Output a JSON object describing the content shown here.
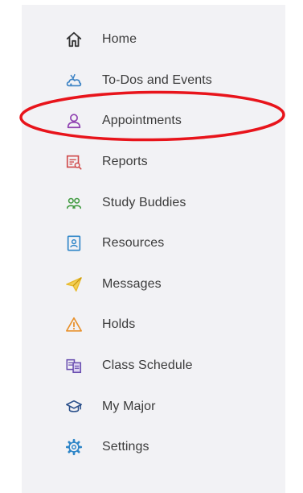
{
  "nav": {
    "items": [
      {
        "label": "Home",
        "icon": "home-icon",
        "color": "#333333"
      },
      {
        "label": "To-Dos and Events",
        "icon": "calendar-cloud-icon",
        "color": "#3b82c4"
      },
      {
        "label": "Appointments",
        "icon": "person-icon",
        "color": "#8e3fb0"
      },
      {
        "label": "Reports",
        "icon": "report-icon",
        "color": "#d04b4b"
      },
      {
        "label": "Study Buddies",
        "icon": "people-icon",
        "color": "#3f9a3f"
      },
      {
        "label": "Resources",
        "icon": "contact-book-icon",
        "color": "#2f86c8"
      },
      {
        "label": "Messages",
        "icon": "paper-plane-icon",
        "color": "#e7b92b"
      },
      {
        "label": "Holds",
        "icon": "warning-icon",
        "color": "#e8912c"
      },
      {
        "label": "Class Schedule",
        "icon": "schedule-icon",
        "color": "#6a4fb0"
      },
      {
        "label": "My Major",
        "icon": "graduation-cap-icon",
        "color": "#2a4f8a"
      },
      {
        "label": "Settings",
        "icon": "gear-icon",
        "color": "#2f86c8"
      }
    ]
  },
  "annotation": {
    "highlight_color": "#e8141b",
    "highlighted_item": "Appointments"
  }
}
